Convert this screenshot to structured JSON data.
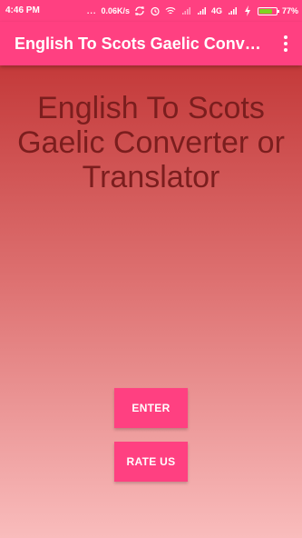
{
  "status_bar": {
    "time": "4:46 PM",
    "dots": "...",
    "speed": "0.06K/s",
    "network": "4G",
    "battery_percent": "77%",
    "battery_level": 0.77,
    "battery_color": "#7ed321"
  },
  "app_bar": {
    "title": "English To Scots Gaelic Conver...",
    "menu_icon": "overflow-menu-icon"
  },
  "main": {
    "heading": "English To Scots Gaelic Converter or Translator",
    "enter_button": "ENTER",
    "rate_button": "RATE US"
  },
  "colors": {
    "accent": "#ff4081",
    "heading_text": "#7b1e1e",
    "gradient_top": "#c43a3a",
    "gradient_bottom": "#f9bcbc"
  }
}
